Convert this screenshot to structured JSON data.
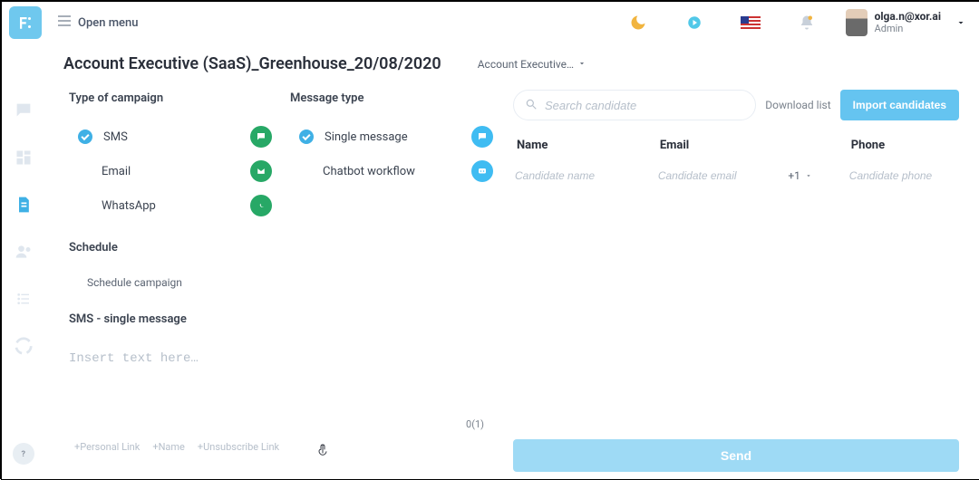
{
  "header": {
    "open_menu": "Open menu",
    "user": {
      "name": "olga.n@xor.ai",
      "role": "Admin"
    }
  },
  "page": {
    "title": "Account Executive (SaaS)_Greenhouse_20/08/2020",
    "selector_label": "Account Executive…"
  },
  "campaign": {
    "type_title": "Type of campaign",
    "types": [
      {
        "label": "SMS",
        "selected": true,
        "icon": "sms-badge"
      },
      {
        "label": "Email",
        "selected": false,
        "icon": "email-badge"
      },
      {
        "label": "WhatsApp",
        "selected": false,
        "icon": "whatsapp-badge"
      }
    ],
    "msgtype_title": "Message type",
    "msgtypes": [
      {
        "label": "Single message",
        "selected": true,
        "icon": "single-msg-badge"
      },
      {
        "label": "Chatbot workflow",
        "selected": false,
        "icon": "chatbot-badge"
      }
    ],
    "schedule_title": "Schedule",
    "schedule_button": "Schedule campaign",
    "composer_title": "SMS - single message",
    "composer_placeholder": "Insert text here…",
    "counter": "0(1)",
    "tags": [
      "+Personal Link",
      "+Name",
      "+Unsubscribe Link"
    ]
  },
  "candidates": {
    "search_placeholder": "Search candidate",
    "download_label": "Download list",
    "import_label": "Import candidates",
    "columns": {
      "name": "Name",
      "email": "Email",
      "phone": "Phone"
    },
    "row": {
      "name_placeholder": "Candidate name",
      "email_placeholder": "Candidate email",
      "country_code": "+1",
      "phone_placeholder": "Candidate phone"
    },
    "send_label": "Send"
  },
  "chart_data": null
}
